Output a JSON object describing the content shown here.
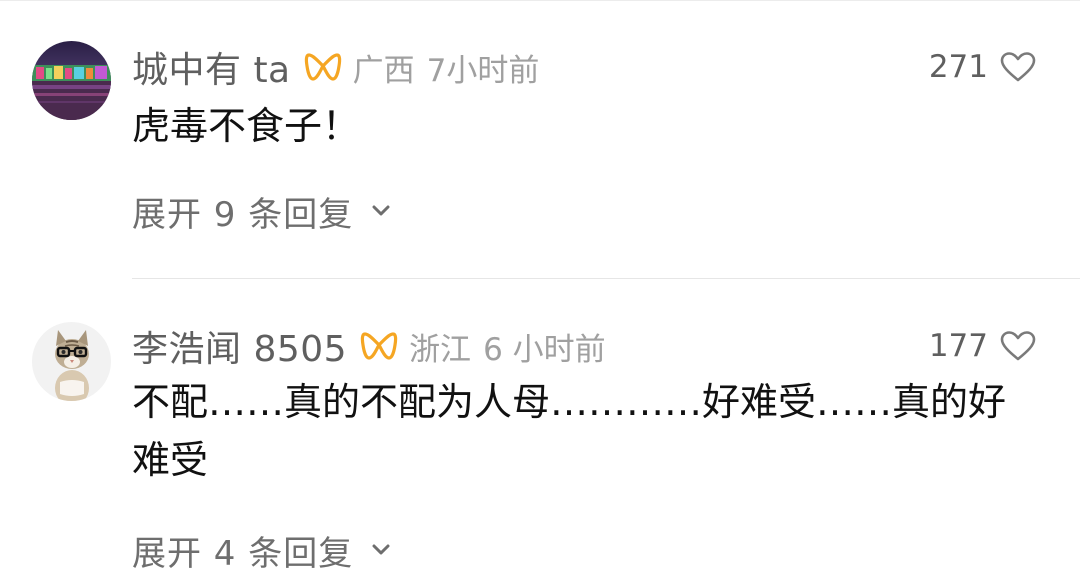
{
  "comments": [
    {
      "username": "城中有 ta",
      "location": "广西",
      "time": "7小时前",
      "likes": "271",
      "text": "虎毒不食子！",
      "replies_label": "展开 9 条回复",
      "avatar": "city-night-lights-avatar"
    },
    {
      "username": "李浩闻 8505",
      "location": "浙江",
      "time": "6 小时前",
      "likes": "177",
      "text": "不配……真的不配为人母…………好难受……真的好难受",
      "replies_label": "展开 4 条回复",
      "avatar": "cat-with-glasses-avatar"
    }
  ],
  "colors": {
    "badge": "#f5a623",
    "username": "#5f5f5f",
    "meta": "#a0a0a0",
    "text": "#111111"
  },
  "icons": [
    "verified-badge-icon",
    "heart-icon",
    "chevron-down-icon"
  ]
}
